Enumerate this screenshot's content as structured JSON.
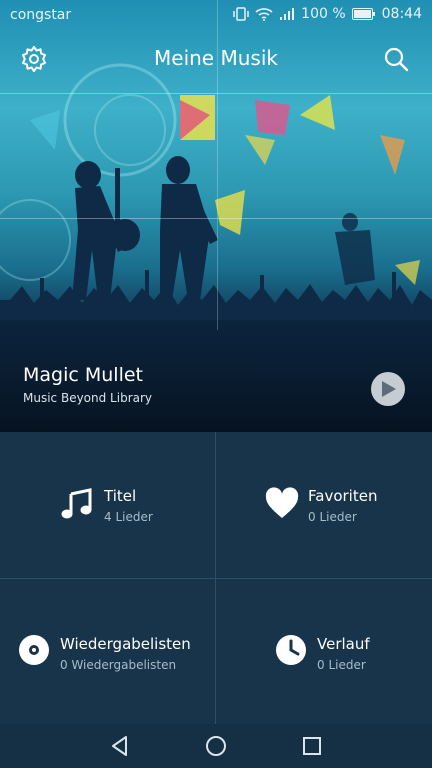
{
  "status": {
    "carrier": "congstar",
    "battery": "100 %",
    "time": "08:44"
  },
  "header": {
    "title": "Meine Musik"
  },
  "album": {
    "title": "Magic Mullet",
    "subtitle": "Music Beyond Library"
  },
  "grid": [
    {
      "label": "Titel",
      "sub": "4 Lieder"
    },
    {
      "label": "Favoriten",
      "sub": "0 Lieder"
    },
    {
      "label": "Wiedergabelisten",
      "sub": "0 Wiedergabelisten"
    },
    {
      "label": "Verlauf",
      "sub": "0 Lieder"
    }
  ],
  "colors": {
    "grid_bg": "#17344a",
    "divider": "#2f4f66",
    "sub_text": "#a7bccb"
  }
}
